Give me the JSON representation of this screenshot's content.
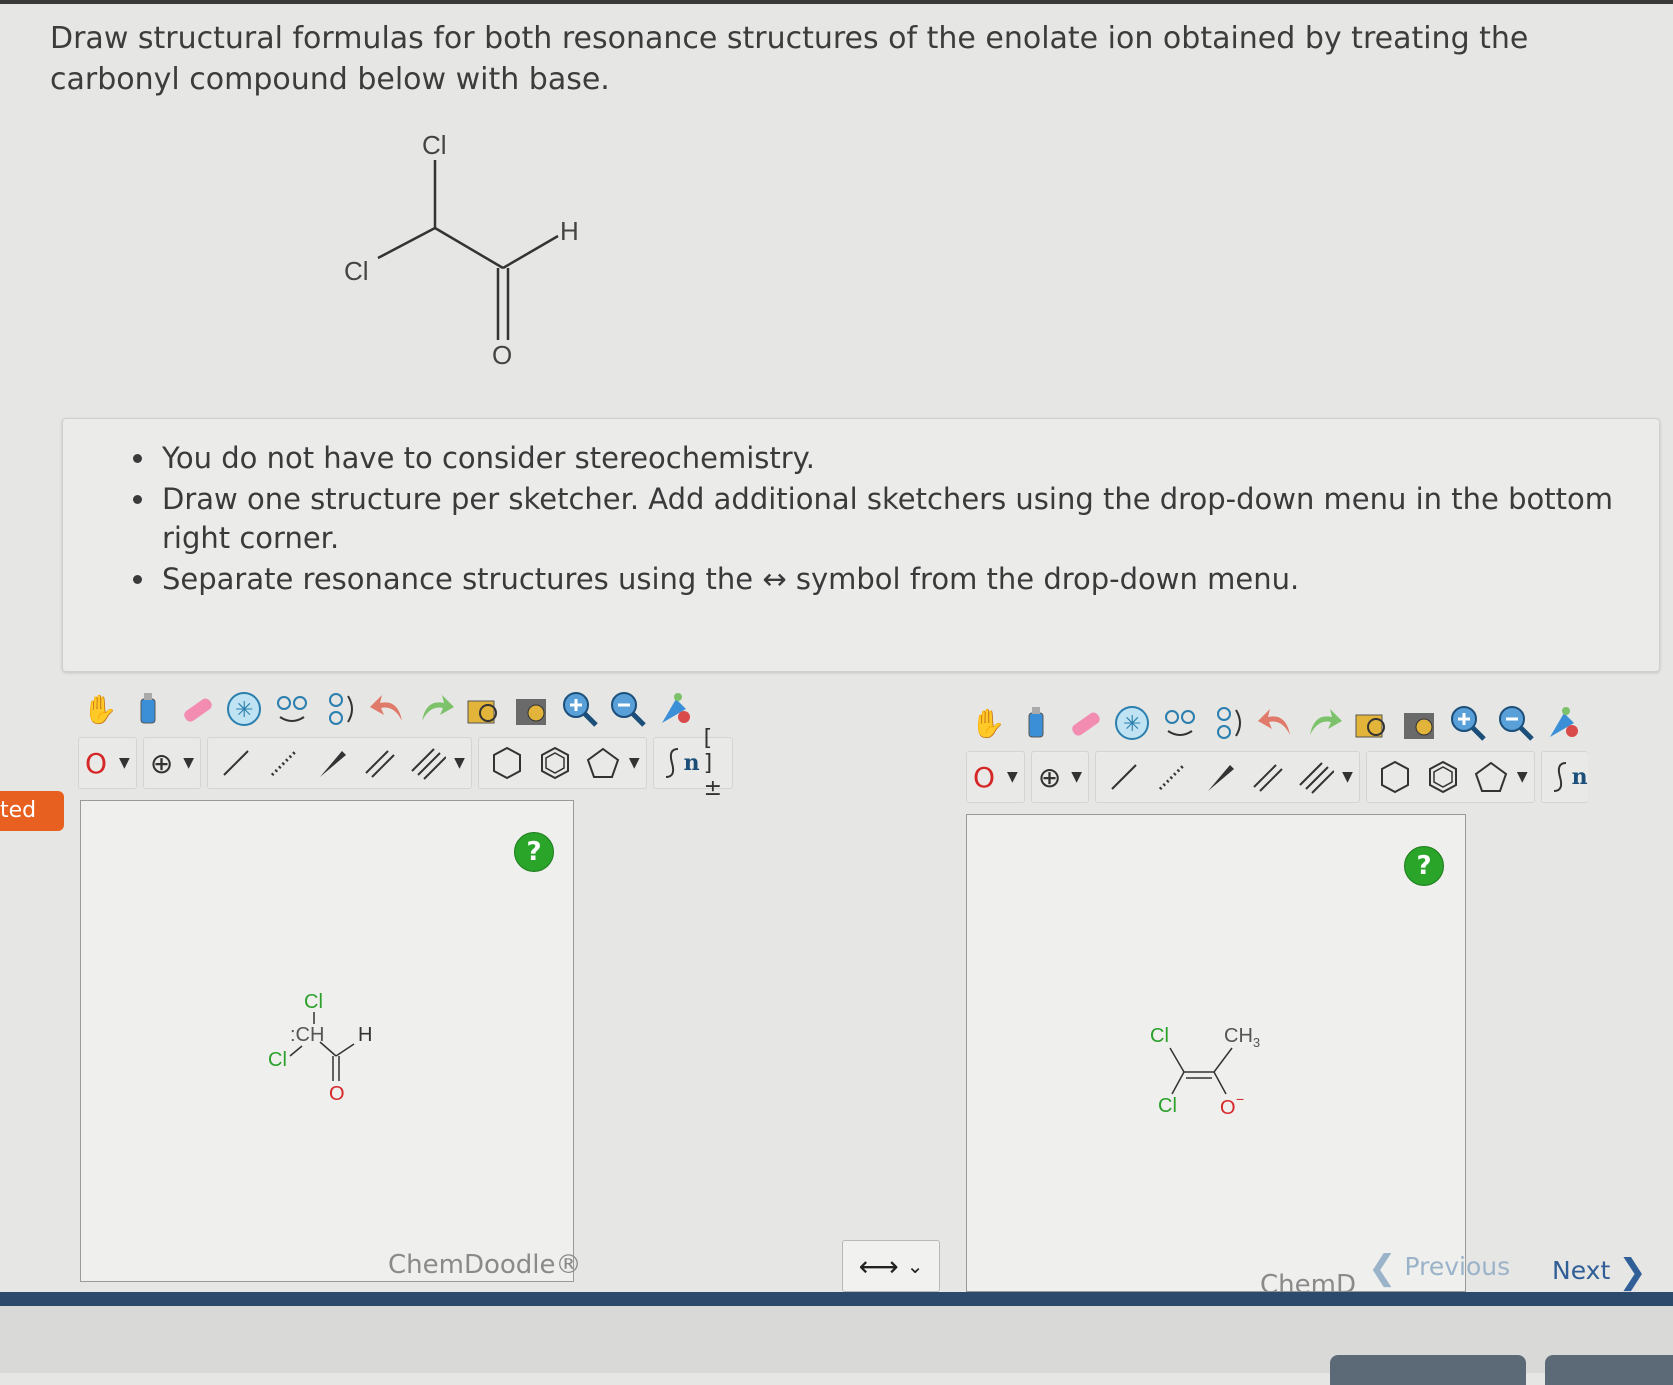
{
  "question": {
    "text": "Draw structural formulas for both resonance structures of the enolate ion obtained by treating the carbonyl compound below with base."
  },
  "molecule": {
    "atom_cl_top": "Cl",
    "atom_cl_left": "Cl",
    "atom_h": "H",
    "atom_o": "O"
  },
  "instructions": {
    "items": [
      "You do not have to consider stereochemistry.",
      "Draw one structure per sketcher. Add additional sketchers using the drop-down menu in the bottom right corner.",
      "Separate resonance structures using the ↔ symbol from the drop-down menu."
    ]
  },
  "tab_label": "ted",
  "toolbar": {
    "element_label": "O",
    "charge_symbol": "⊕",
    "sgroup_label": "n",
    "bracket_label": "[ ]±"
  },
  "sketcher1": {
    "help_label": "?",
    "brand": "ChemDoodle®",
    "structure": {
      "cl_top": "Cl",
      "ch": ":CH",
      "cl_left": "Cl",
      "h": "H",
      "o": "O"
    }
  },
  "sketcher2": {
    "help_label": "?",
    "brand": "ChemD",
    "structure": {
      "cl_top": "Cl",
      "ch3": "CH",
      "ch3_sub": "3",
      "cl_bottom": "Cl",
      "o": "O",
      "o_charge": "−"
    }
  },
  "resonance_select": {
    "value": "⟷",
    "chevron": "⌄"
  },
  "nav": {
    "previous": "Previous",
    "next": "Next"
  },
  "colors": {
    "accent_orange": "#e8601f",
    "help_green": "#2aa52a",
    "chlorine_green": "#2ca02c",
    "oxygen_red": "#d62728",
    "nav_blue": "#2f5f96"
  }
}
